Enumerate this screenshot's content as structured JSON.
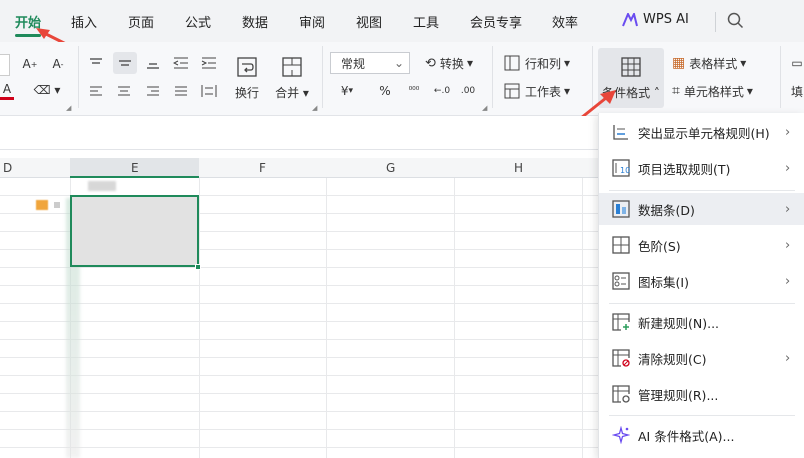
{
  "tabs": [
    {
      "label": "开始",
      "active": true
    },
    {
      "label": "插入"
    },
    {
      "label": "页面"
    },
    {
      "label": "公式"
    },
    {
      "label": "数据"
    },
    {
      "label": "审阅"
    },
    {
      "label": "视图"
    },
    {
      "label": "工具"
    },
    {
      "label": "会员专享"
    },
    {
      "label": "效率"
    },
    {
      "label": "WPS AI"
    }
  ],
  "ribbon": {
    "number_format": "常规",
    "convert": "转换",
    "rows_cols": "行和列",
    "wrap": "换行",
    "merge": "合并",
    "worksheet": "工作表",
    "conditional_format": "条件格式",
    "table_style": "表格样式",
    "cell_style": "单元格样式",
    "fill": "填",
    "yen": "¥",
    "percent": "%"
  },
  "columns": [
    "D",
    "E",
    "F",
    "G",
    "H"
  ],
  "menu": {
    "items": [
      {
        "label": "突出显示单元格规则(H)",
        "submenu": true
      },
      {
        "label": "项目选取规则(T)",
        "submenu": true
      },
      {
        "label": "数据条(D)",
        "submenu": true,
        "hover": true
      },
      {
        "label": "色阶(S)",
        "submenu": true
      },
      {
        "label": "图标集(I)",
        "submenu": true
      },
      {
        "label": "新建规则(N)...",
        "submenu": false
      },
      {
        "label": "清除规则(C)",
        "submenu": true
      },
      {
        "label": "管理规则(R)...",
        "submenu": false
      },
      {
        "label": "AI 条件格式(A)...",
        "submenu": false
      }
    ]
  },
  "colors": {
    "accent": "#1f8a5b",
    "annotation": "#e8463a"
  }
}
